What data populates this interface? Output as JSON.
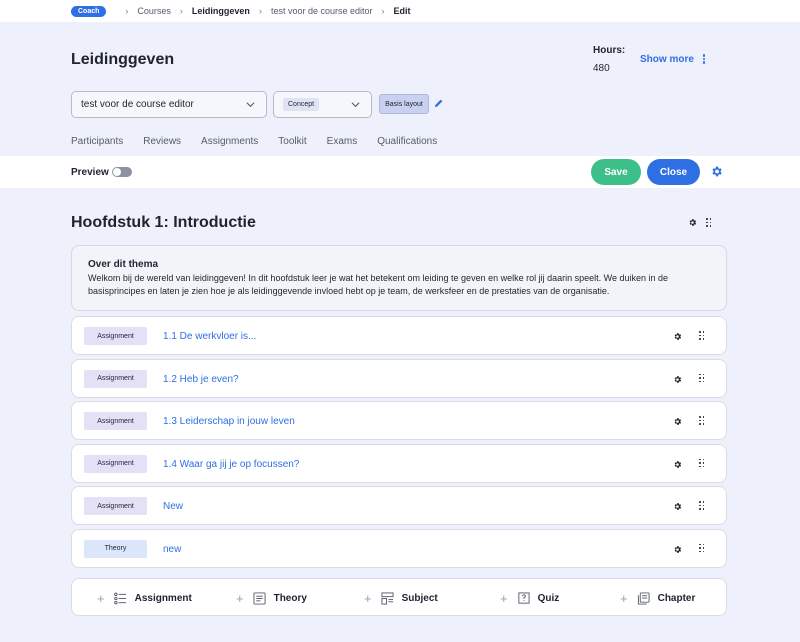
{
  "breadcrumb": {
    "role_badge": "Coach",
    "items": [
      "Courses",
      "Leidinggeven",
      "test voor de course editor",
      "Edit"
    ]
  },
  "header": {
    "title": "Leidinggeven",
    "hours_label": "Hours:",
    "hours_value": "480",
    "show_more": "Show more",
    "course_select_value": "test voor de course editor",
    "status_select_value": "Concept",
    "layout_label": "Basis layout"
  },
  "tabs": [
    "Participants",
    "Reviews",
    "Assignments",
    "Toolkit",
    "Exams",
    "Qualifications"
  ],
  "toolbar": {
    "preview_label": "Preview",
    "preview_enabled": false,
    "save_label": "Save",
    "close_label": "Close"
  },
  "chapter": {
    "title": "Hoofdstuk 1: Introductie",
    "about_title": "Over dit thema",
    "about_text": "Welkom bij de wereld van leidinggeven! In dit hoofdstuk leer je wat het betekent om leiding te geven en welke rol jij daarin speelt. We duiken in de basisprincipes en laten je zien hoe je als leidinggevende invloed hebt op je team, de werksfeer en de prestaties van de organisatie.",
    "items": [
      {
        "type": "Assignment",
        "title": "1.1 De werkvloer is..."
      },
      {
        "type": "Assignment",
        "title": "1.2 Heb je even?"
      },
      {
        "type": "Assignment",
        "title": "1.3 Leiderschap in jouw leven"
      },
      {
        "type": "Assignment",
        "title": "1.4 Waar ga jij je op focussen?"
      },
      {
        "type": "Assignment",
        "title": "New"
      },
      {
        "type": "Theory",
        "title": "new"
      }
    ]
  },
  "add_bar": [
    {
      "label": "Assignment",
      "icon": "list-icon"
    },
    {
      "label": "Theory",
      "icon": "document-icon"
    },
    {
      "label": "Subject",
      "icon": "layout-icon"
    },
    {
      "label": "Quiz",
      "icon": "quiz-icon"
    },
    {
      "label": "Chapter",
      "icon": "copy-icon"
    }
  ],
  "colors": {
    "accent": "#2f6fe4",
    "save": "#3ebf8a",
    "background": "#eef0fb"
  }
}
